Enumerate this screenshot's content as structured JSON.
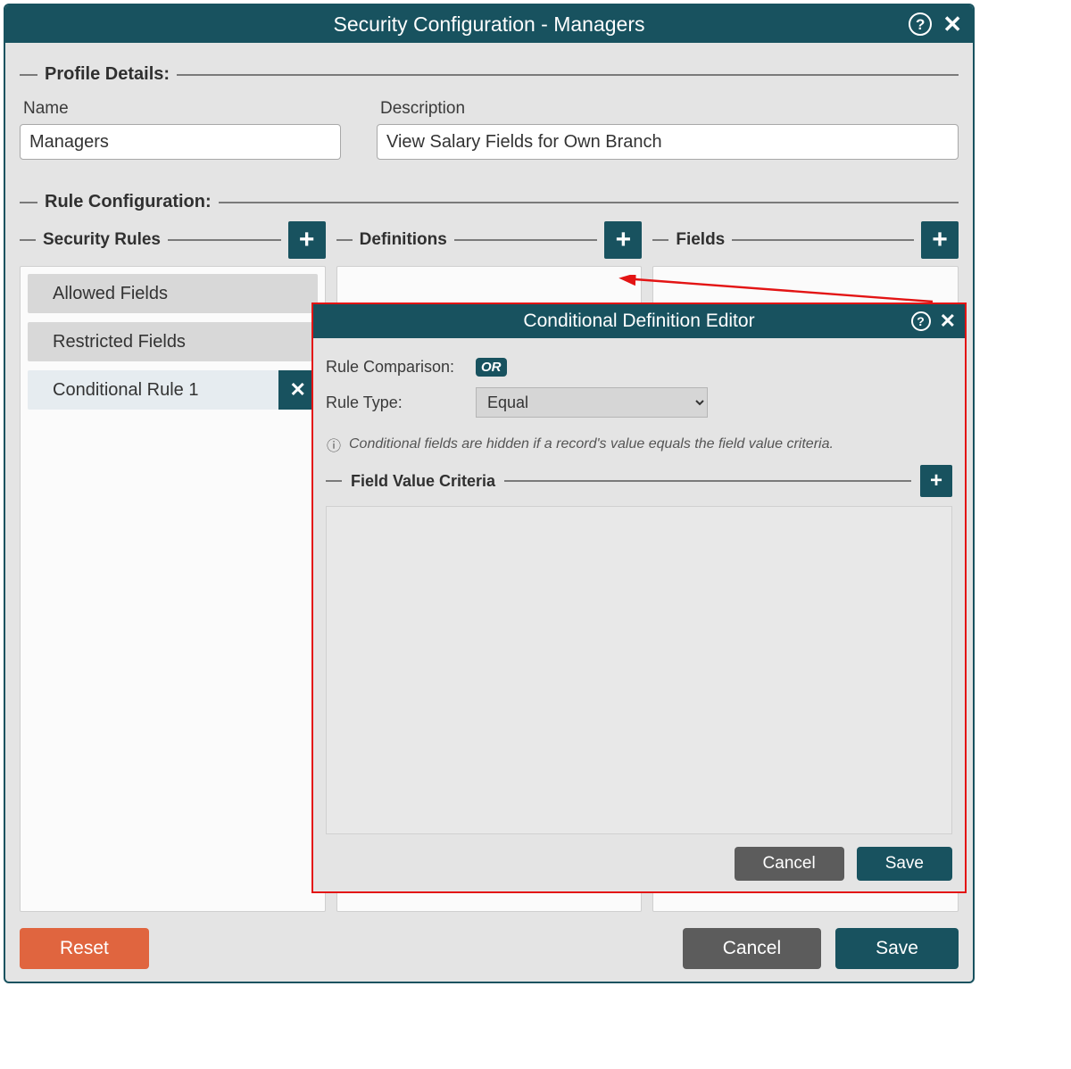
{
  "main": {
    "title": "Security Configuration - Managers",
    "profile_section": "Profile Details:",
    "name_label": "Name",
    "name_value": "Managers",
    "desc_label": "Description",
    "desc_value": "View Salary Fields for Own Branch",
    "rule_config_section": "Rule Configuration:",
    "columns": {
      "rules": "Security Rules",
      "definitions": "Definitions",
      "fields": "Fields"
    },
    "rule_items": [
      {
        "label": "Allowed Fields",
        "selected": false,
        "deletable": false
      },
      {
        "label": "Restricted Fields",
        "selected": false,
        "deletable": false
      },
      {
        "label": "Conditional Rule 1",
        "selected": true,
        "deletable": true
      }
    ],
    "buttons": {
      "reset": "Reset",
      "cancel": "Cancel",
      "save": "Save"
    }
  },
  "modal": {
    "title": "Conditional Definition Editor",
    "comparison_label": "Rule Comparison:",
    "comparison_value": "OR",
    "type_label": "Rule Type:",
    "type_value": "Equal",
    "hint": "Conditional fields are hidden if a record's value equals the field value criteria.",
    "criteria_label": "Field Value Criteria",
    "buttons": {
      "cancel": "Cancel",
      "save": "Save"
    }
  }
}
